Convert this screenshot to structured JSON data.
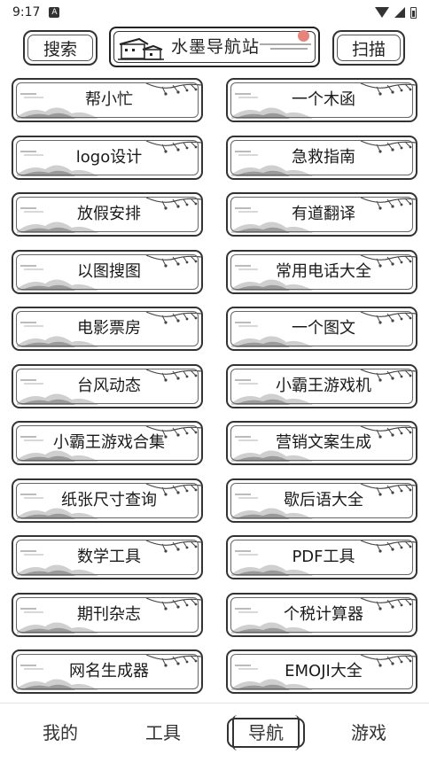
{
  "status_bar": {
    "time": "9:17",
    "notification_badge": "A",
    "icons": [
      "wifi-icon",
      "signal-icon",
      "battery-icon"
    ]
  },
  "header": {
    "search_label": "搜索",
    "title": "水墨导航站",
    "scan_label": "扫描"
  },
  "tools": [
    {
      "label": "帮小忙"
    },
    {
      "label": "一个木函"
    },
    {
      "label": "logo设计"
    },
    {
      "label": "急救指南"
    },
    {
      "label": "放假安排"
    },
    {
      "label": "有道翻译"
    },
    {
      "label": "以图搜图"
    },
    {
      "label": "常用电话大全"
    },
    {
      "label": "电影票房"
    },
    {
      "label": "一个图文"
    },
    {
      "label": "台风动态"
    },
    {
      "label": "小霸王游戏机"
    },
    {
      "label": "小霸王游戏合集"
    },
    {
      "label": "营销文案生成"
    },
    {
      "label": "纸张尺寸查询"
    },
    {
      "label": "歇后语大全"
    },
    {
      "label": "数学工具"
    },
    {
      "label": "PDF工具"
    },
    {
      "label": "期刊杂志"
    },
    {
      "label": "个税计算器"
    },
    {
      "label": "网名生成器"
    },
    {
      "label": "EMOJI大全"
    }
  ],
  "bottom_nav": {
    "mine": "我的",
    "tools": "工具",
    "guide": "导航",
    "game": "游戏",
    "active": "导航"
  },
  "colors": {
    "ink": "#333333",
    "sun_accent": "#e8837a",
    "background": "#ffffff"
  }
}
